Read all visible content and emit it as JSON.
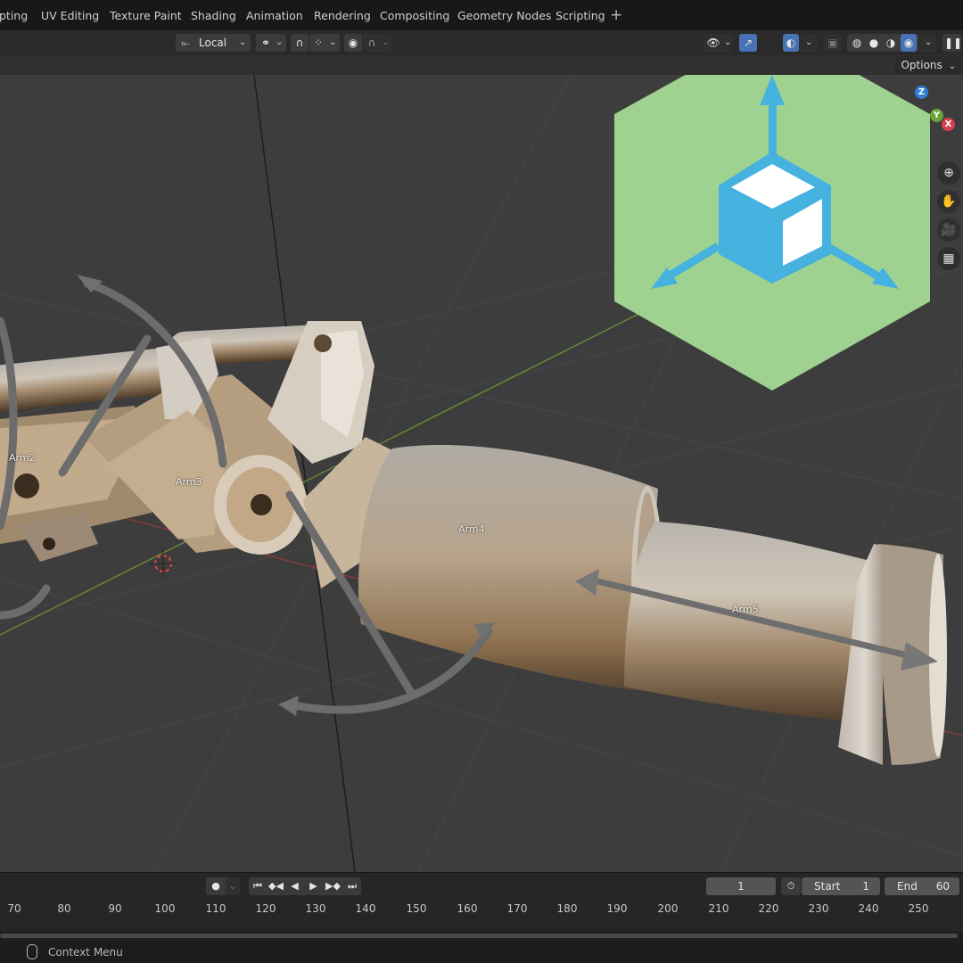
{
  "workspace_tabs": [
    "pting",
    "UV Editing",
    "Texture Paint",
    "Shading",
    "Animation",
    "Rendering",
    "Compositing",
    "Geometry Nodes",
    "Scripting"
  ],
  "add_workspace_symbol": "+",
  "header": {
    "pivot_label": "Local",
    "options_label": "Options"
  },
  "axis_gizmo": {
    "z": "Z",
    "y": "Y",
    "x": "X"
  },
  "overlay_colors": {
    "hex_bg": "#9fd290",
    "cube_blue": "#45b2e0"
  },
  "objects": [
    "Arm2",
    "Arm3",
    "Arm4",
    "Arm5"
  ],
  "timeline": {
    "current_frame": "1",
    "start_label": "Start",
    "start_value": "1",
    "end_label": "End",
    "end_value": "60",
    "ruler": [
      "70",
      "80",
      "90",
      "100",
      "110",
      "120",
      "130",
      "140",
      "150",
      "160",
      "170",
      "180",
      "190",
      "200",
      "210",
      "220",
      "230",
      "240",
      "250"
    ]
  },
  "status": {
    "context_menu": "Context Menu"
  }
}
